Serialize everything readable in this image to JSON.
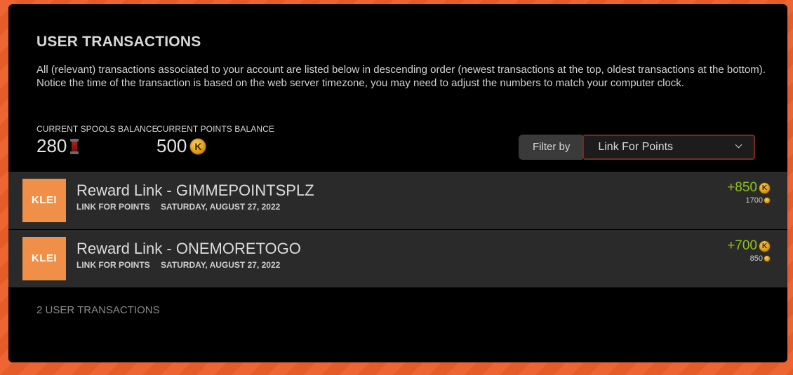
{
  "page": {
    "title": "USER TRANSACTIONS",
    "intro": "All (relevant) transactions associated to your account are listed below in descending order (newest transactions at the top, oldest transactions at the bottom). Notice the time of the transaction is based on the web server timezone, you may need to adjust the numbers to match your computer clock."
  },
  "balances": {
    "spools": {
      "label": "CURRENT SPOOLS BALANCE",
      "value": "280",
      "icon": "spool-icon"
    },
    "points": {
      "label": "CURRENT POINTS BALANCE",
      "value": "500",
      "icon": "klei-points-coin-icon"
    }
  },
  "filter": {
    "label": "Filter by",
    "selected": "Link For Points"
  },
  "transactions": [
    {
      "logo": "KLEI",
      "title": "Reward Link - GIMMEPOINTSPLZ",
      "type": "LINK FOR POINTS",
      "date": "SATURDAY, AUGUST 27, 2022",
      "amount": "+850",
      "running_total": "1700"
    },
    {
      "logo": "KLEI",
      "title": "Reward Link - ONEMORETOGO",
      "type": "LINK FOR POINTS",
      "date": "SATURDAY, AUGUST 27, 2022",
      "amount": "+700",
      "running_total": "850"
    }
  ],
  "footer": {
    "count_label": "2 USER TRANSACTIONS"
  },
  "colors": {
    "background": "#ec5f2a",
    "panel": "#000000",
    "row": "#2a2a2a",
    "amount_positive": "#8ec21e",
    "logo": "#f09048",
    "select_border": "#7a2a1a"
  }
}
